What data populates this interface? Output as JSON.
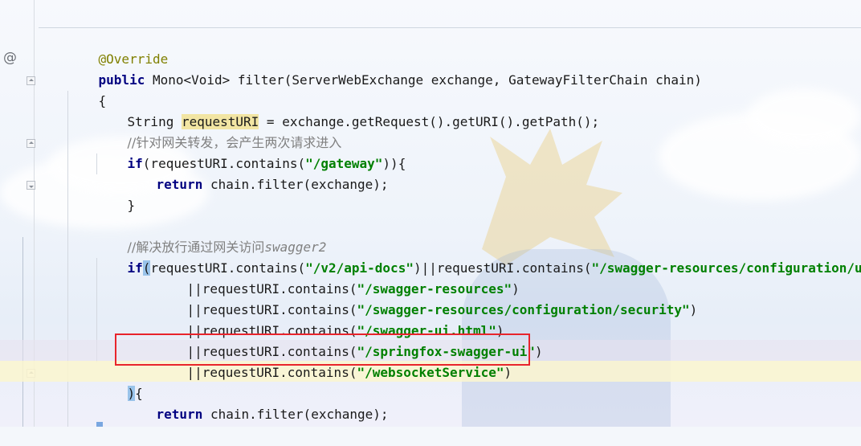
{
  "editor": {
    "gutter_marker": "@",
    "lines": {
      "l1": {
        "ann": "@Override"
      },
      "l2": {
        "kw1": "public",
        "rest": " Mono<Void> filter(ServerWebExchange exchange, GatewayFilterChain chain)"
      },
      "l3": {
        "text": "{"
      },
      "l4": {
        "pre": "String ",
        "var": "requestURI",
        "post": " = exchange.getRequest().getURI().getPath();"
      },
      "l5": {
        "cmt": "//针对网关转发，会产生两次请求进入"
      },
      "l6": {
        "kw": "if",
        "pre": "(requestURI.contains(",
        "str": "\"/gateway\"",
        "post": ")){"
      },
      "l7": {
        "kw": "return",
        "rest": " chain.filter(exchange);"
      },
      "l8": {
        "text": "}"
      },
      "l9": {
        "cmt_cn": "//解决放行通过网关访问",
        "cmt_en": "swagger2"
      },
      "l10": {
        "kw": "if",
        "paren": "(",
        "pre": "requestURI.contains(",
        "s1": "\"/v2/api-docs\"",
        "mid": ")||requestURI.contains(",
        "s2": "\"/swagger-resources/configuration/ui\"",
        "post": ")"
      },
      "l11": {
        "pre": "||requestURI.contains(",
        "str": "\"/swagger-resources\"",
        "post": ")"
      },
      "l12": {
        "pre": "||requestURI.contains(",
        "str": "\"/swagger-resources/configuration/security\"",
        "post": ")"
      },
      "l13": {
        "pre": "||requestURI.contains(",
        "str": "\"/swagger-ui.html\"",
        "post": ")"
      },
      "l14": {
        "pre": "||requestURI.contains(",
        "str": "\"/springfox-swagger-ui\"",
        "post": ")"
      },
      "l15": {
        "pre": "||requestURI.contains(",
        "str": "\"/websocketService\"",
        "post": ")"
      },
      "l16": {
        "paren": ")",
        "post": "{"
      },
      "l17": {
        "kw": "return",
        "rest": " chain.filter(exchange);"
      }
    },
    "colors": {
      "keyword": "#000080",
      "string": "#008000",
      "annotation": "#808000",
      "comment": "#808080",
      "highlight_box": "#e8242c"
    }
  }
}
